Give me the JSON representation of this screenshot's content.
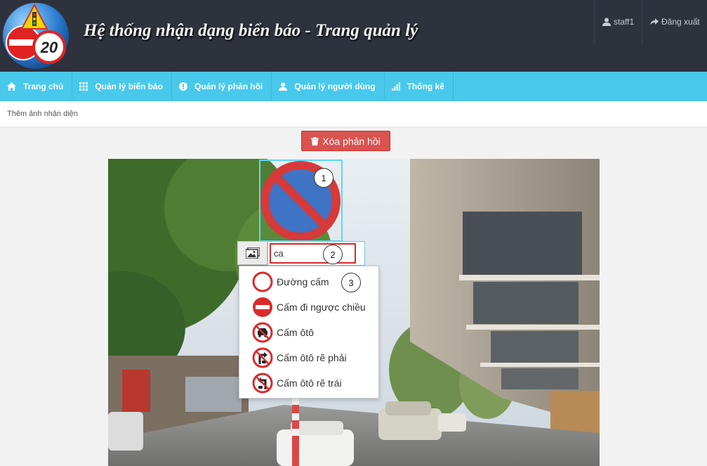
{
  "header": {
    "title": "Hệ thống nhận dạng biển báo - Trang quản lý",
    "logo_number": "20",
    "user": "staff1",
    "logout": "Đăng xuất"
  },
  "nav": {
    "items": [
      {
        "label": "Trang chủ",
        "icon": "home-icon"
      },
      {
        "label": "Quản lý biển báo",
        "icon": "grid-icon"
      },
      {
        "label": "Quản lý phản hồi",
        "icon": "alert-icon"
      },
      {
        "label": "Quản lý người dùng",
        "icon": "user-icon"
      },
      {
        "label": "Thống kê",
        "icon": "bar-chart-icon"
      }
    ]
  },
  "breadcrumb": "Thêm ảnh nhận diện",
  "delete_button": "Xóa phản hồi",
  "annotator": {
    "search_value": "ca",
    "markers": [
      "1",
      "2",
      "3"
    ],
    "suggestions": [
      {
        "label": "Đường cấm",
        "icon": "no-entry-both-icon"
      },
      {
        "label": "Cấm đi ngược chiều",
        "icon": "no-entry-icon"
      },
      {
        "label": "Cấm ôtô",
        "icon": "no-cars-icon"
      },
      {
        "label": "Cấm ôtô rẽ phải",
        "icon": "no-car-right-turn-icon"
      },
      {
        "label": "Cấm ôtô rẽ trái",
        "icon": "no-car-left-turn-icon"
      }
    ]
  },
  "colors": {
    "header_bg": "#2d323d",
    "nav_bg": "#48c9ec",
    "danger": "#d9534f",
    "highlight": "#5fd6f4"
  }
}
